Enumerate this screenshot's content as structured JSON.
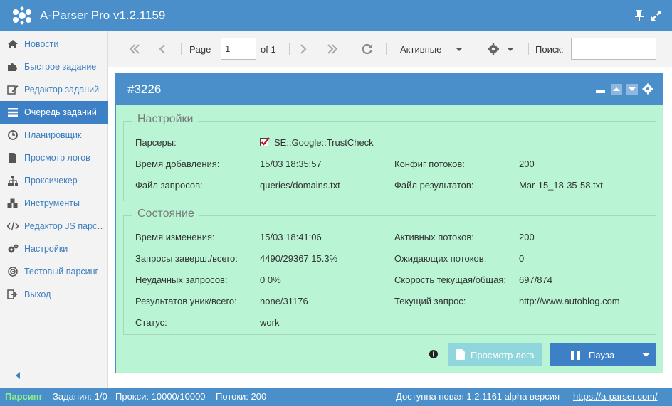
{
  "app": {
    "title": "A-Parser Pro v1.2.1159"
  },
  "sidebar": {
    "items": [
      {
        "label": "Новости",
        "icon": "home-icon"
      },
      {
        "label": "Быстрое задание",
        "icon": "puzzle-icon"
      },
      {
        "label": "Редактор заданий",
        "icon": "edit-icon"
      },
      {
        "label": "Очередь заданий",
        "icon": "list-icon",
        "active": true
      },
      {
        "label": "Планировщик",
        "icon": "clock-icon"
      },
      {
        "label": "Просмотр логов",
        "icon": "file-icon"
      },
      {
        "label": "Проксичекер",
        "icon": "sitemap-icon"
      },
      {
        "label": "Инструменты",
        "icon": "cubes-icon"
      },
      {
        "label": "Редактор JS парс…",
        "icon": "code-icon"
      },
      {
        "label": "Настройки",
        "icon": "gears-icon"
      },
      {
        "label": "Тестовый парсинг",
        "icon": "target-icon"
      },
      {
        "label": "Выход",
        "icon": "sign-out-icon"
      }
    ]
  },
  "toolbar": {
    "page_label": "Page",
    "page_value": "1",
    "of_label": "of 1",
    "filter_label": "Активные",
    "search_label": "Поиск:",
    "search_value": ""
  },
  "task": {
    "title": "#3226",
    "settings": {
      "legend": "Настройки",
      "parsers_label": "Парсеры:",
      "parsers_value": "SE::Google::TrustCheck",
      "added_label": "Время добавления:",
      "added_value": "15/03 18:35:57",
      "threads_config_label": "Конфиг потоков:",
      "threads_config_value": "200",
      "queries_file_label": "Файл запросов:",
      "queries_file_value": "queries/domains.txt",
      "results_file_label": "Файл результатов:",
      "results_file_value": "Mar-15_18-35-58.txt"
    },
    "state": {
      "legend": "Состояние",
      "changed_label": "Время изменения:",
      "changed_value": "15/03 18:41:06",
      "active_threads_label": "Активных потоков:",
      "active_threads_value": "200",
      "queries_done_label": "Запросы заверш./всего:",
      "queries_done_value": "4490/29367 15.3%",
      "waiting_threads_label": "Ожидающих потоков:",
      "waiting_threads_value": "0",
      "failed_label": "Неудачных запросов:",
      "failed_value": "0 0%",
      "speed_label": "Скорость текущая/общая:",
      "speed_value": "697/874",
      "results_label": "Результатов уник/всего:",
      "results_value": "none/31176",
      "current_query_label": "Текущий запрос:",
      "current_query_value": "http://www.autoblog.com",
      "status_label": "Статус:",
      "status_value": "work"
    },
    "buttons": {
      "view_log": "Просмотр лога",
      "pause": "Пауза"
    }
  },
  "statusbar": {
    "parsing": "Парсинг",
    "tasks": "Задания: 1/0",
    "proxies": "Прокси: 10000/10000",
    "threads": "Потоки: 200",
    "update_notice": "Доступна новая 1.2.1161 alpha версия",
    "link": "https://a-parser.com/"
  },
  "colors": {
    "header_blue": "#4a8fca",
    "active_blue": "#3e80c5",
    "panel_green": "#b9f5d5",
    "parsing_green": "#8ff08a"
  }
}
